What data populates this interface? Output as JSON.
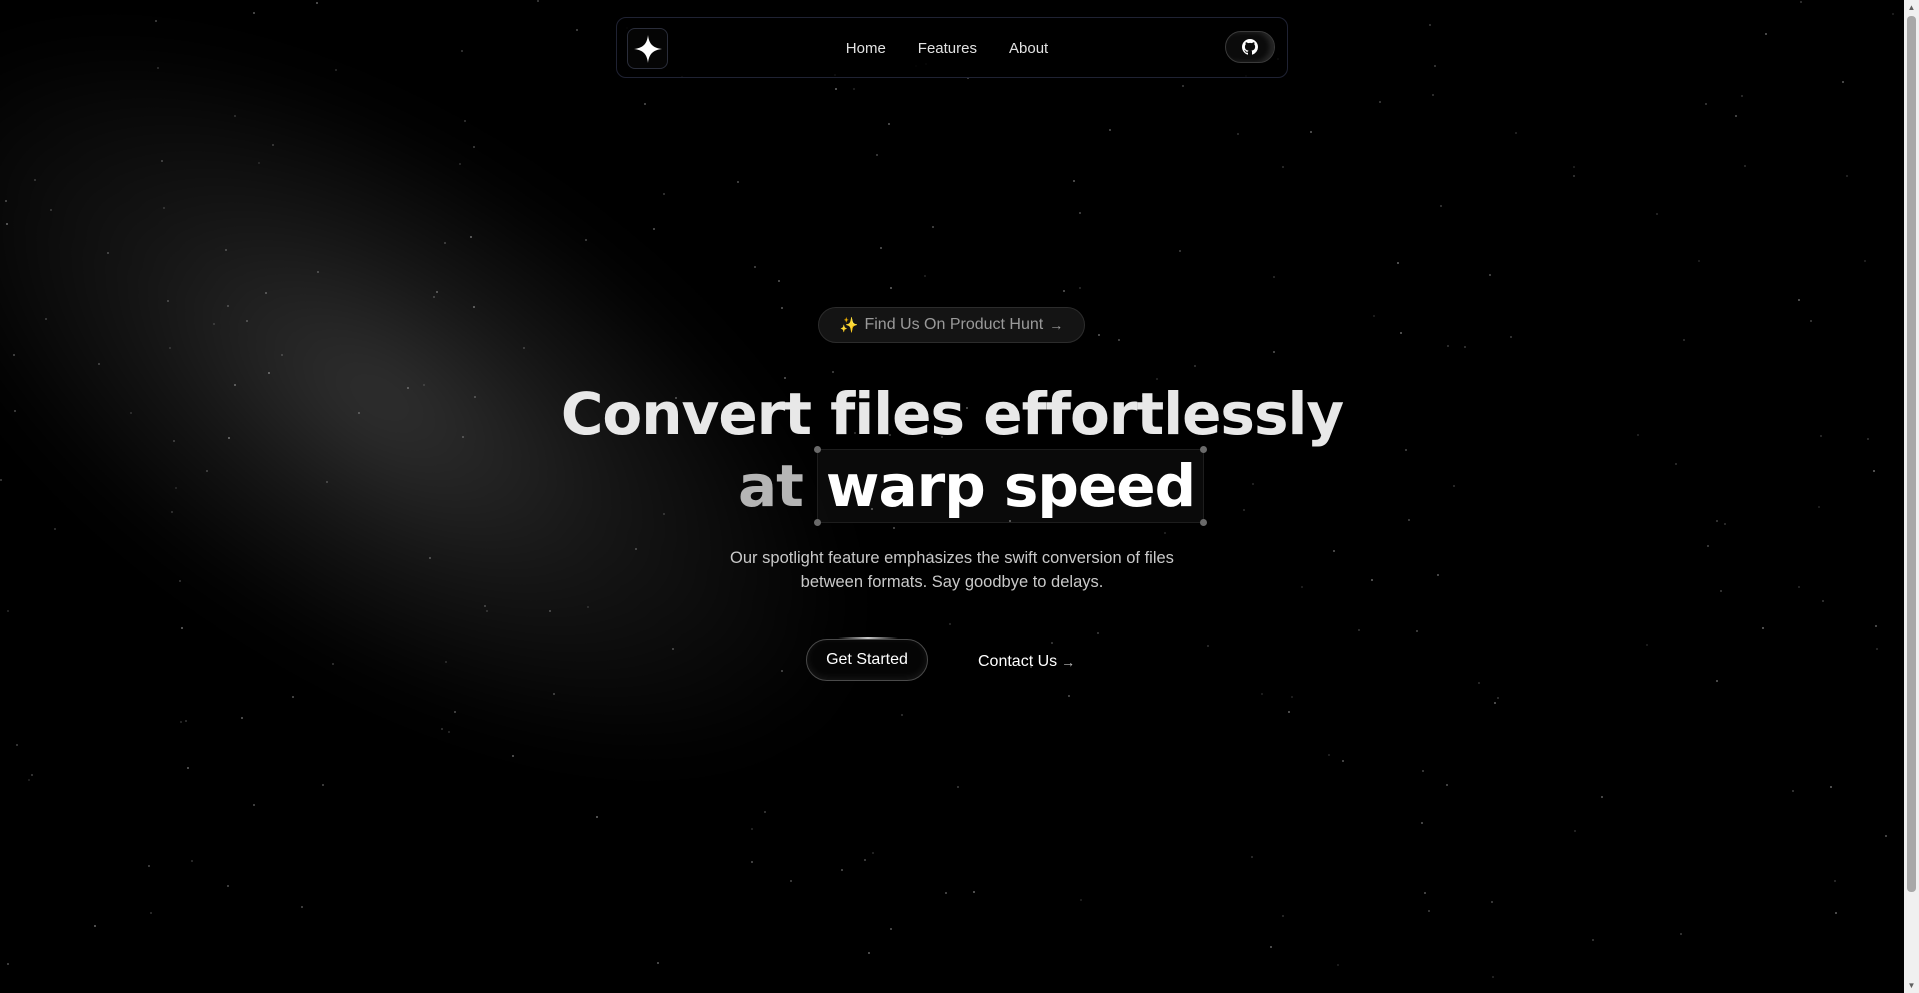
{
  "nav": {
    "links": [
      "Home",
      "Features",
      "About"
    ],
    "logo_icon": "sparkle-icon",
    "github_icon": "github-icon"
  },
  "badge": {
    "icon": "sparkles-icon",
    "emoji": "✨",
    "label": "Find Us On Product Hunt",
    "arrow": "→"
  },
  "hero": {
    "line1": "Convert files effortlessly",
    "line2_prefix": "at",
    "line2_highlight": "warp speed",
    "subtitle_line1": "Our spotlight feature emphasizes the swift conversion of files",
    "subtitle_line2": "between formats. Say goodbye to delays."
  },
  "cta": {
    "primary": "Get Started",
    "secondary": "Contact Us",
    "secondary_arrow": "→"
  },
  "colors": {
    "background": "#000000",
    "nav_border": "#1f2233",
    "badge_bg": "#141414",
    "badge_text": "#9a9a9a",
    "headline": "#e8e8e8",
    "spark": "#f2c14e"
  }
}
